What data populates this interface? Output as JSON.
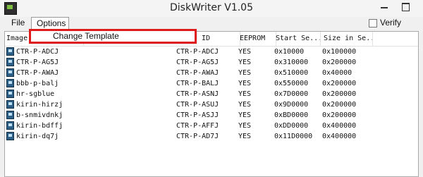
{
  "window": {
    "title": "DiskWriter V1.05"
  },
  "menubar": {
    "file_label": "File",
    "options_label": "Options"
  },
  "options_menu": {
    "items": [
      {
        "label": "Change Template"
      }
    ]
  },
  "verify": {
    "label": "Verify",
    "checked": false
  },
  "table": {
    "columns": [
      "Image ...",
      "ID",
      "EEPROM",
      "Start Se...",
      "Size in Se..."
    ],
    "rows": [
      {
        "image": "CTR-P-ADCJ",
        "id": "CTR-P-ADCJ",
        "eeprom": "YES",
        "start": "0x10000",
        "size": "0x100000"
      },
      {
        "image": "CTR-P-AG5J",
        "id": "CTR-P-AG5J",
        "eeprom": "YES",
        "start": "0x310000",
        "size": "0x200000"
      },
      {
        "image": "CTR-P-AWAJ",
        "id": "CTR-P-AWAJ",
        "eeprom": "YES",
        "start": "0x510000",
        "size": "0x40000"
      },
      {
        "image": "bbb-p-balj",
        "id": "CTR-P-BALJ",
        "eeprom": "YES",
        "start": "0x550000",
        "size": "0x200000"
      },
      {
        "image": "hr-sgblue",
        "id": "CTR-P-ASNJ",
        "eeprom": "YES",
        "start": "0x7D0000",
        "size": "0x200000"
      },
      {
        "image": "kirin-hirzj",
        "id": "CTR-P-ASUJ",
        "eeprom": "YES",
        "start": "0x9D0000",
        "size": "0x200000"
      },
      {
        "image": "b-snmivdnkj",
        "id": "CTR-P-ASJJ",
        "eeprom": "YES",
        "start": "0xBD0000",
        "size": "0x200000"
      },
      {
        "image": "kirin-bdffj",
        "id": "CTR-P-AFFJ",
        "eeprom": "YES",
        "start": "0xDD0000",
        "size": "0x400000"
      },
      {
        "image": "kirin-dq7j",
        "id": "CTR-P-AD7J",
        "eeprom": "YES",
        "start": "0x11D0000",
        "size": "0x400000"
      }
    ]
  },
  "icons": {
    "app": "disk-writer-app-icon",
    "row": "cartridge-icon"
  },
  "colors": {
    "highlight": "#e01b1b",
    "row_icon": "#2d5f86"
  }
}
